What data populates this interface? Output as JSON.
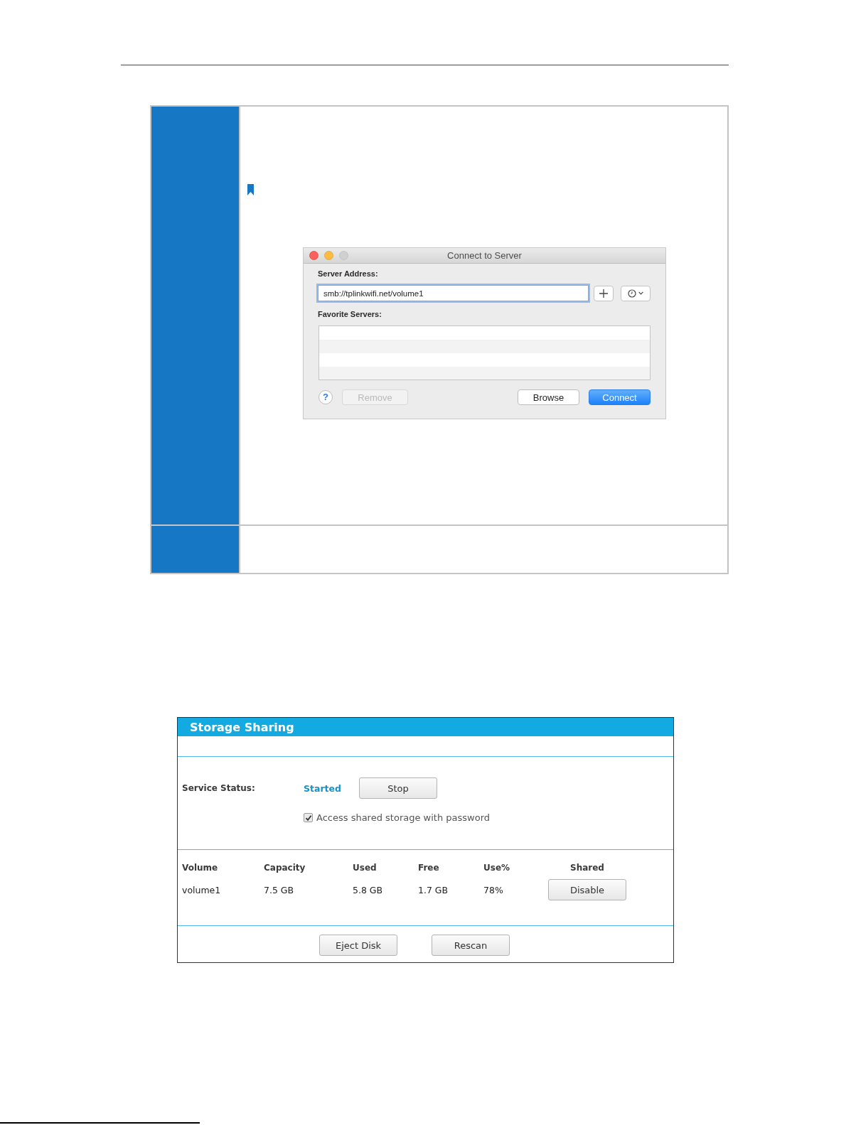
{
  "dialog": {
    "title": "Connect to Server",
    "server_address": {
      "label": "Server Address:",
      "value": "smb://tplinkwifi.net/volume1",
      "focused": true
    },
    "favorites": {
      "label": "Favorite Servers:"
    },
    "help_button": "?",
    "left_buttons": [
      {
        "label": "Remove",
        "disabled": true
      }
    ],
    "right_buttons": [
      {
        "label": "Browse",
        "disabled": false,
        "default": false
      },
      {
        "label": "Connect",
        "disabled": false,
        "default": true
      }
    ]
  },
  "storage_sharing": {
    "title": "Storage Sharing",
    "service_status": {
      "label": "Service Status:",
      "value": "Started",
      "button": "Stop"
    },
    "password_access": {
      "label": "Access shared storage with password",
      "checked": true
    },
    "volumes": {
      "columns": [
        "Volume",
        "Capacity",
        "Used",
        "Free",
        "Use%",
        "Shared"
      ],
      "rows": [
        {
          "cells": [
            "volume1",
            "7.5 GB",
            "5.8 GB",
            "1.7 GB",
            "78%"
          ],
          "button": "Disable"
        }
      ]
    },
    "buttons": [
      "Eject Disk",
      "Rescan"
    ]
  }
}
